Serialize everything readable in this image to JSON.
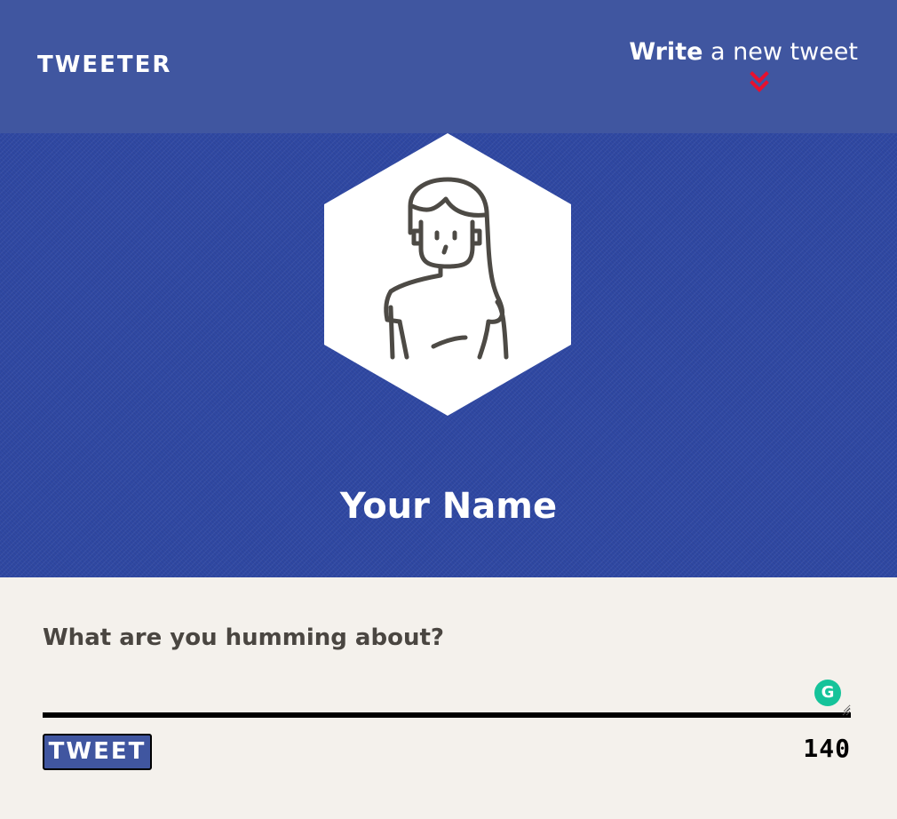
{
  "nav": {
    "brand": "TWEETER",
    "compose_strong": "Write",
    "compose_rest": " a new tweet",
    "arrow_icon": "double-chevron-down-icon",
    "arrow_color": "#e8102e",
    "background": "#4056a0"
  },
  "profile": {
    "avatar_icon": "user-avatar-icon",
    "display_name": "Your Name",
    "hero_color": "#2f48a2"
  },
  "composer": {
    "prompt": "What are you humming about?",
    "tweet_value": "",
    "grammarly_icon": "grammarly-icon",
    "grammarly_glyph": "G",
    "button_label": "TWEET",
    "char_count": "140"
  }
}
